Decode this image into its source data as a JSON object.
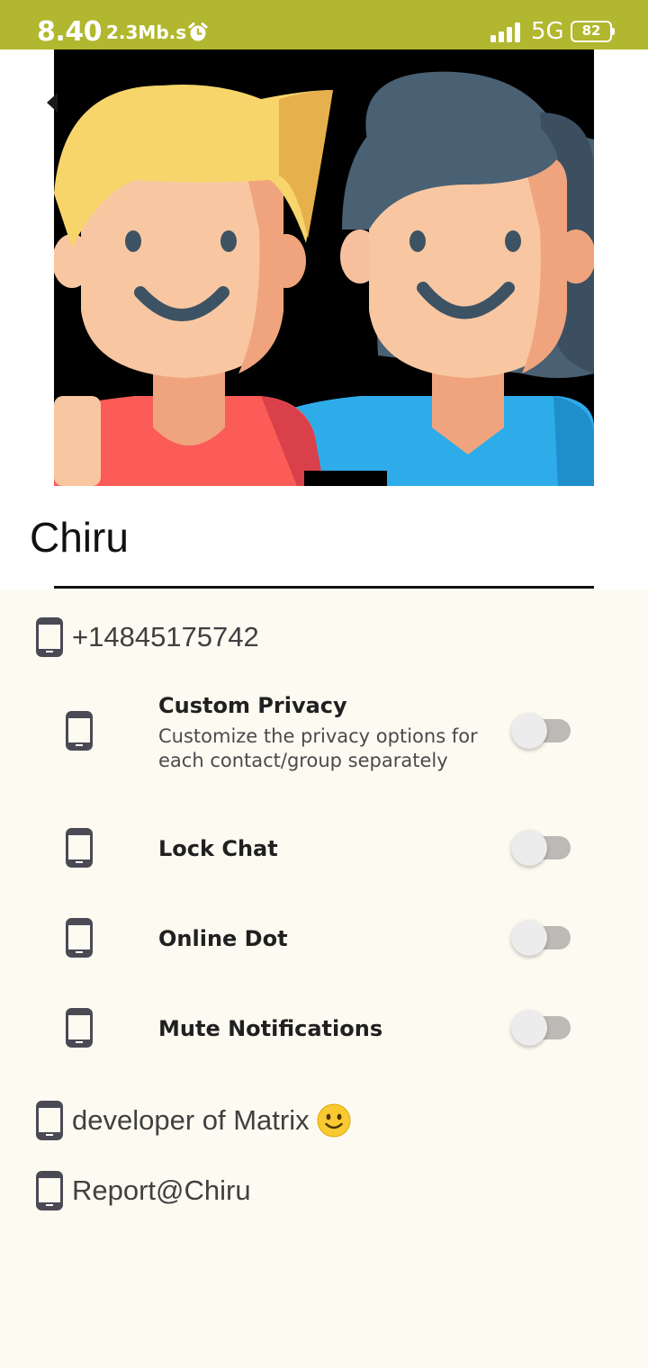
{
  "status_bar": {
    "time": "8.40",
    "speed": "2.3Mb.s",
    "network": "5G",
    "battery": "82",
    "icons": [
      "alarm-icon",
      "signal-icon",
      "battery-icon"
    ],
    "color": "#b1b72e"
  },
  "profile": {
    "name": "Chiru",
    "phone": "+14845175742",
    "about": "developer of Matrix",
    "report": "Report@Chiru"
  },
  "settings": [
    {
      "title": "Custom Privacy",
      "subtitle": "Customize the privacy options for each contact/group separately",
      "enabled": false
    },
    {
      "title": "Lock Chat",
      "subtitle": "",
      "enabled": false
    },
    {
      "title": "Online Dot",
      "subtitle": "",
      "enabled": false
    },
    {
      "title": "Mute Notifications",
      "subtitle": "",
      "enabled": false
    }
  ],
  "colors": {
    "background": "#fdfaf1",
    "icon": "#4a4a55",
    "toggle_track": "#bdbab5",
    "toggle_thumb": "#ececec"
  }
}
